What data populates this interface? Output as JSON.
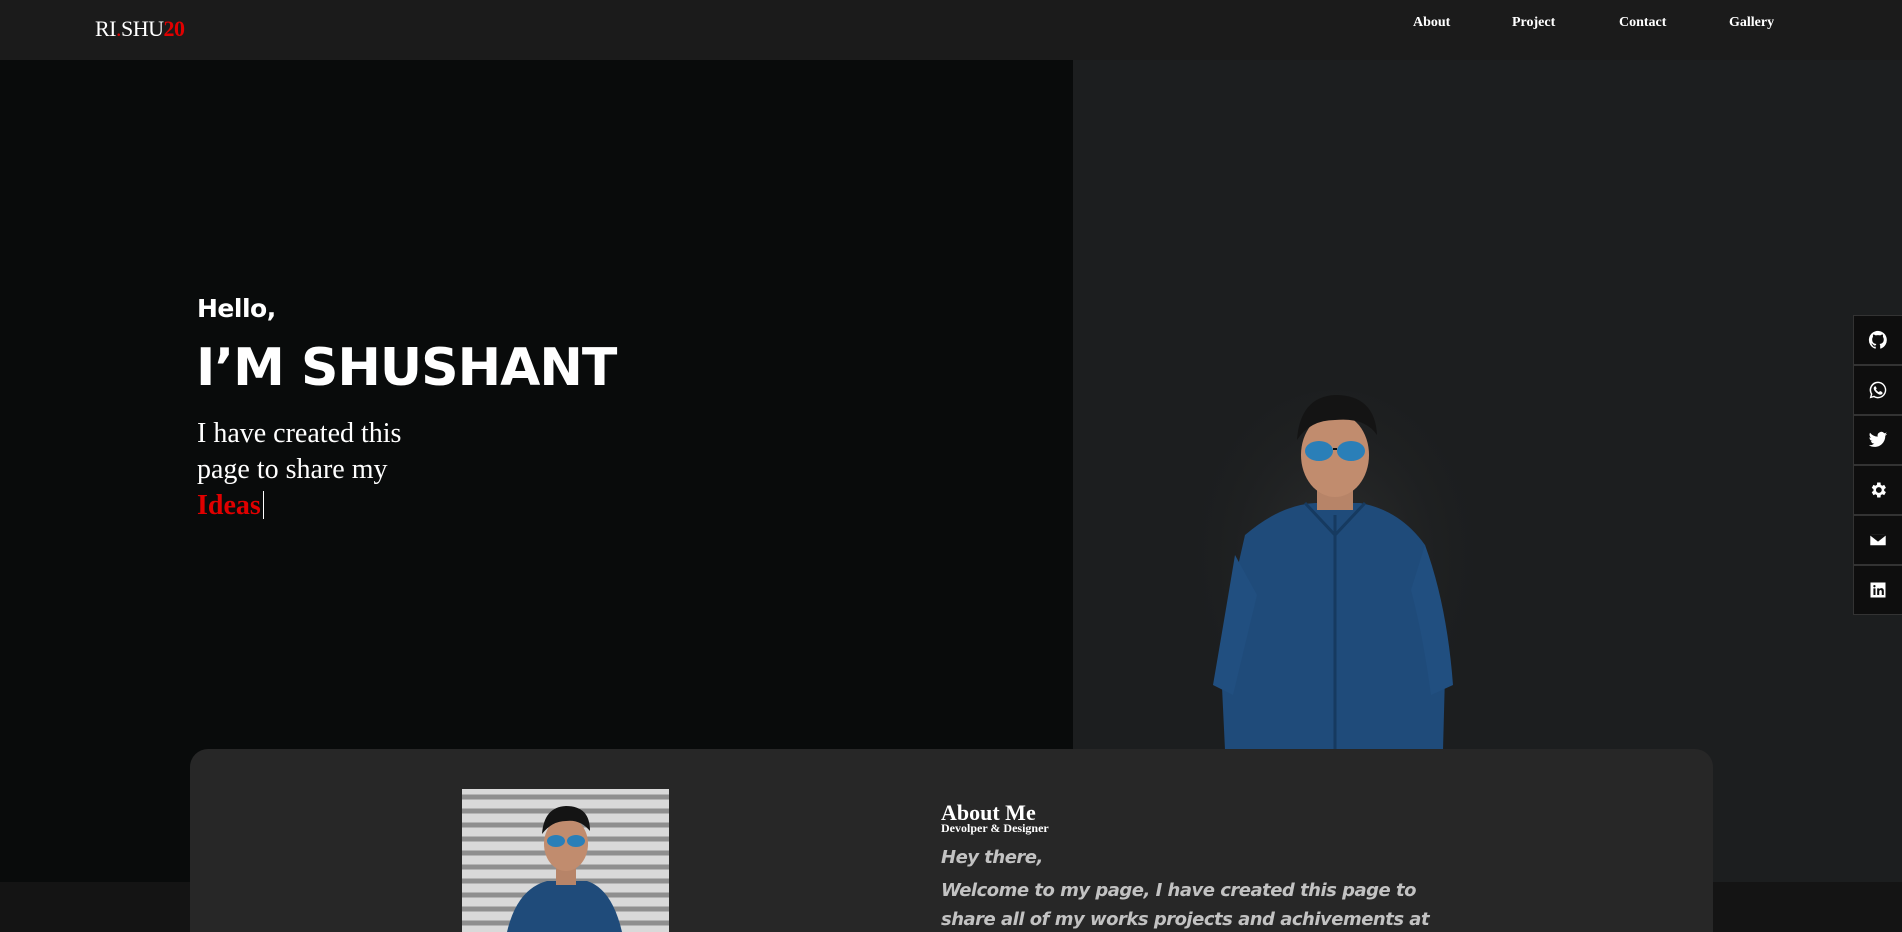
{
  "nav": {
    "logo_part1": "RI",
    "logo_dot": ".",
    "logo_part2": "SHU",
    "logo_num": "20",
    "links": [
      "About",
      "Project",
      "Contact",
      "Gallery"
    ]
  },
  "hero": {
    "greeting": "Hello,",
    "name": "I’M SHUSHANT",
    "tagline": "I have created this page to share my",
    "typed_word": "Ideas"
  },
  "social": [
    "github-icon",
    "whatsapp-icon",
    "twitter-icon",
    "settings-icon",
    "email-icon",
    "linkedin-icon"
  ],
  "about": {
    "title": "About Me",
    "subtitle": "Devolper & Designer",
    "greeting": "Hey there,",
    "text": "Welcome to my page, I have created this page to share all of my works projects and achivements at one place you can"
  },
  "colors": {
    "accent": "#e00000",
    "nav_bg": "#1b1b1b",
    "hero_left_bg": "#090b0b",
    "hero_right_bg": "#1c1e1f",
    "card_bg": "#272727"
  }
}
